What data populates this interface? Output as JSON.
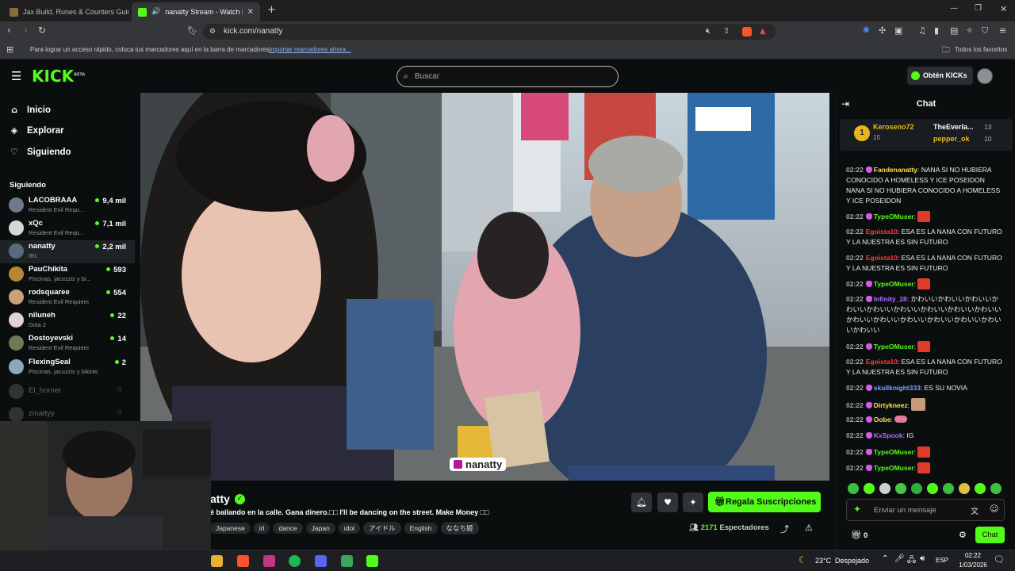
{
  "browser": {
    "tabs": [
      {
        "title": "Jax Build, Runes & Counters Guide fo",
        "active": false
      },
      {
        "title": "nanatty Stream - Watch Live o",
        "active": true
      }
    ],
    "url": "kick.com/nanatty",
    "bookmarks_hint": "Para lograr un acceso rápido, coloca tus marcadores aquí en la barra de marcadores.",
    "bookmarks_link": "Importar marcadores ahora...",
    "bookmarks_folder": "Todos los favoritos"
  },
  "header": {
    "logo": "KICK",
    "logo_badge": "BETA",
    "search_placeholder": "Buscar",
    "get_kicks": "Obtén KICKs"
  },
  "sidebar": {
    "nav": [
      {
        "label": "Inicio",
        "icon": "home-icon"
      },
      {
        "label": "Explorar",
        "icon": "compass-icon"
      },
      {
        "label": "Siguiendo",
        "icon": "heart-icon"
      }
    ],
    "section_title": "Siguiendo",
    "channels": [
      {
        "name": "LACOBRAAA",
        "category": "Resident Evil Requ...",
        "viewers": "9,4 mil",
        "color": "#6c7a8a"
      },
      {
        "name": "xQc",
        "category": "Resident Evil Requ...",
        "viewers": "7,1 mil",
        "color": "#d7d7d7"
      },
      {
        "name": "nanatty",
        "category": "IRL",
        "viewers": "2,2 mil",
        "color": "#556a7d"
      },
      {
        "name": "PauChikita",
        "category": "Piscinas, jacuzzis y bi...",
        "viewers": "593",
        "color": "#b8862f"
      },
      {
        "name": "rodsquaree",
        "category": "Resident Evil Requiem",
        "viewers": "554",
        "color": "#c9a27b"
      },
      {
        "name": "niluneh",
        "category": "Dota 2",
        "viewers": "22",
        "color": "#e0d3d8"
      },
      {
        "name": "Dostoyevski",
        "category": "Resident Evil Requiem",
        "viewers": "14",
        "color": "#6f7a55"
      },
      {
        "name": "FlexingSeal",
        "category": "Piscinas, jacuzzis y bikinis",
        "viewers": "2",
        "color": "#8fa6bd"
      }
    ],
    "offline": [
      "El_hornet",
      "zmattyy"
    ]
  },
  "stream": {
    "streamer": "atty",
    "title": "é bailando en la calle. Gana dinero.□□ I'll be dancing on the street. Make Money □□",
    "tags": [
      "Japanese",
      "irl",
      "dance",
      "Japan",
      "idol",
      "アイドル",
      "English",
      "ななち姫"
    ],
    "gift_button": "Regala Suscripciones",
    "viewers_count": "2171",
    "viewers_label": "Espectadores",
    "watermark": "nanatty"
  },
  "chat": {
    "title": "Chat",
    "leaderboard": [
      {
        "rank": "1",
        "name": "Keroseno72",
        "count": "15"
      },
      {
        "name": "TheEverla...",
        "count": "13"
      },
      {
        "name": "pepper_ok",
        "count": "10"
      }
    ],
    "messages": [
      {
        "time": "02:22",
        "user": "Fandenanatty",
        "color": "#ffe04a",
        "text": "NANA SI NO HUBIERA CONOCIDO A HOMELESS Y ICE POSEIDON NANA SI NO HUBIERA CONOCIDO A HOMELESS Y ICE POSEIDON"
      },
      {
        "time": "02:22",
        "user": "TypeOMuser",
        "color": "#53fc18",
        "text": ""
      },
      {
        "time": "02:22",
        "user": "Egoista10",
        "color": "#ff3c3c",
        "text": "ESA ES LA NANA CON FUTURO Y LA NUESTRA ES SIN FUTURO"
      },
      {
        "time": "02:22",
        "user": "Egoista10",
        "color": "#ff3c3c",
        "text": "ESA ES LA NANA CON FUTURO Y LA NUESTRA ES SIN FUTURO"
      },
      {
        "time": "02:22",
        "user": "TypeOMuser",
        "color": "#53fc18",
        "text": ""
      },
      {
        "time": "02:22",
        "user": "Infinity_28",
        "color": "#a970ff",
        "text": "かわいいかわいいかわいいかわいいかわいいかわいいかわいいかわいいかわいいかわいいかわいいかわいいかわいいかわいいかわいいかわいい"
      },
      {
        "time": "02:22",
        "user": "TypeOMuser",
        "color": "#53fc18",
        "text": ""
      },
      {
        "time": "02:22",
        "user": "Egoista10",
        "color": "#ff3c3c",
        "text": "ESA ES LA NANA CON FUTURO Y LA NUESTRA ES SIN FUTURO"
      },
      {
        "time": "02:22",
        "user": "skullknight333",
        "color": "#6fa8ff",
        "text": "ES SU NOVIA"
      },
      {
        "time": "02:22",
        "user": "Dirtykneez",
        "color": "#ffe04a",
        "text": ""
      },
      {
        "time": "02:22",
        "user": "Oobe",
        "color": "#ffe04a",
        "text": ""
      },
      {
        "time": "02:22",
        "user": "KxSpook",
        "color": "#a970ff",
        "text": "IG"
      },
      {
        "time": "02:22",
        "user": "TypeOMuser",
        "color": "#53fc18",
        "text": ""
      },
      {
        "time": "02:22",
        "user": "TypeOMuser",
        "color": "#53fc18",
        "text": ""
      }
    ],
    "input_placeholder": "Enviar un mensaje",
    "kicks_count": "0",
    "send_button": "Chat"
  },
  "taskbar": {
    "weather": "23°C",
    "weather_text": "Despejado",
    "lang": "ESP",
    "time": "02:22",
    "date": "1/03/2026"
  },
  "colors": {
    "accent": "#53fc18",
    "bg": "#0b0e0f"
  }
}
